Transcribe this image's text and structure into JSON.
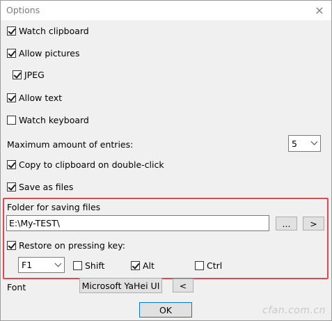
{
  "window": {
    "title": "Options",
    "close_glyph": "✕"
  },
  "options": {
    "watch_clipboard": {
      "label": "Watch clipboard",
      "checked": true
    },
    "allow_pictures": {
      "label": "Allow pictures",
      "checked": true
    },
    "jpeg": {
      "label": "JPEG",
      "checked": true
    },
    "allow_text": {
      "label": "Allow text",
      "checked": true
    },
    "watch_keyboard": {
      "label": "Watch keyboard",
      "checked": false
    },
    "max_entries": {
      "label": "Maximum amount of entries:",
      "value": "5"
    },
    "copy_on_double_click": {
      "label": "Copy to clipboard on double-click",
      "checked": true
    },
    "save_as_files": {
      "label": "Save as files",
      "checked": true
    },
    "folder": {
      "label": "Folder for saving files",
      "value": "E:\\My-TEST\\",
      "browse_label": "...",
      "open_label": ">"
    },
    "restore_on_key": {
      "label": "Restore on pressing key:",
      "checked": true
    },
    "hotkey": {
      "value": "F1"
    },
    "shift": {
      "label": "Shift",
      "checked": false
    },
    "alt": {
      "label": "Alt",
      "checked": true
    },
    "ctrl": {
      "label": "Ctrl",
      "checked": false
    },
    "font": {
      "label": "Font",
      "value": "Microsoft YaHei UI",
      "reset_label": "<"
    }
  },
  "footer": {
    "ok_label": "OK"
  },
  "watermark": {
    "text": "cfan.com.cn"
  },
  "colors": {
    "highlight": "#e2484f",
    "default_button_border": "#0078d7"
  }
}
